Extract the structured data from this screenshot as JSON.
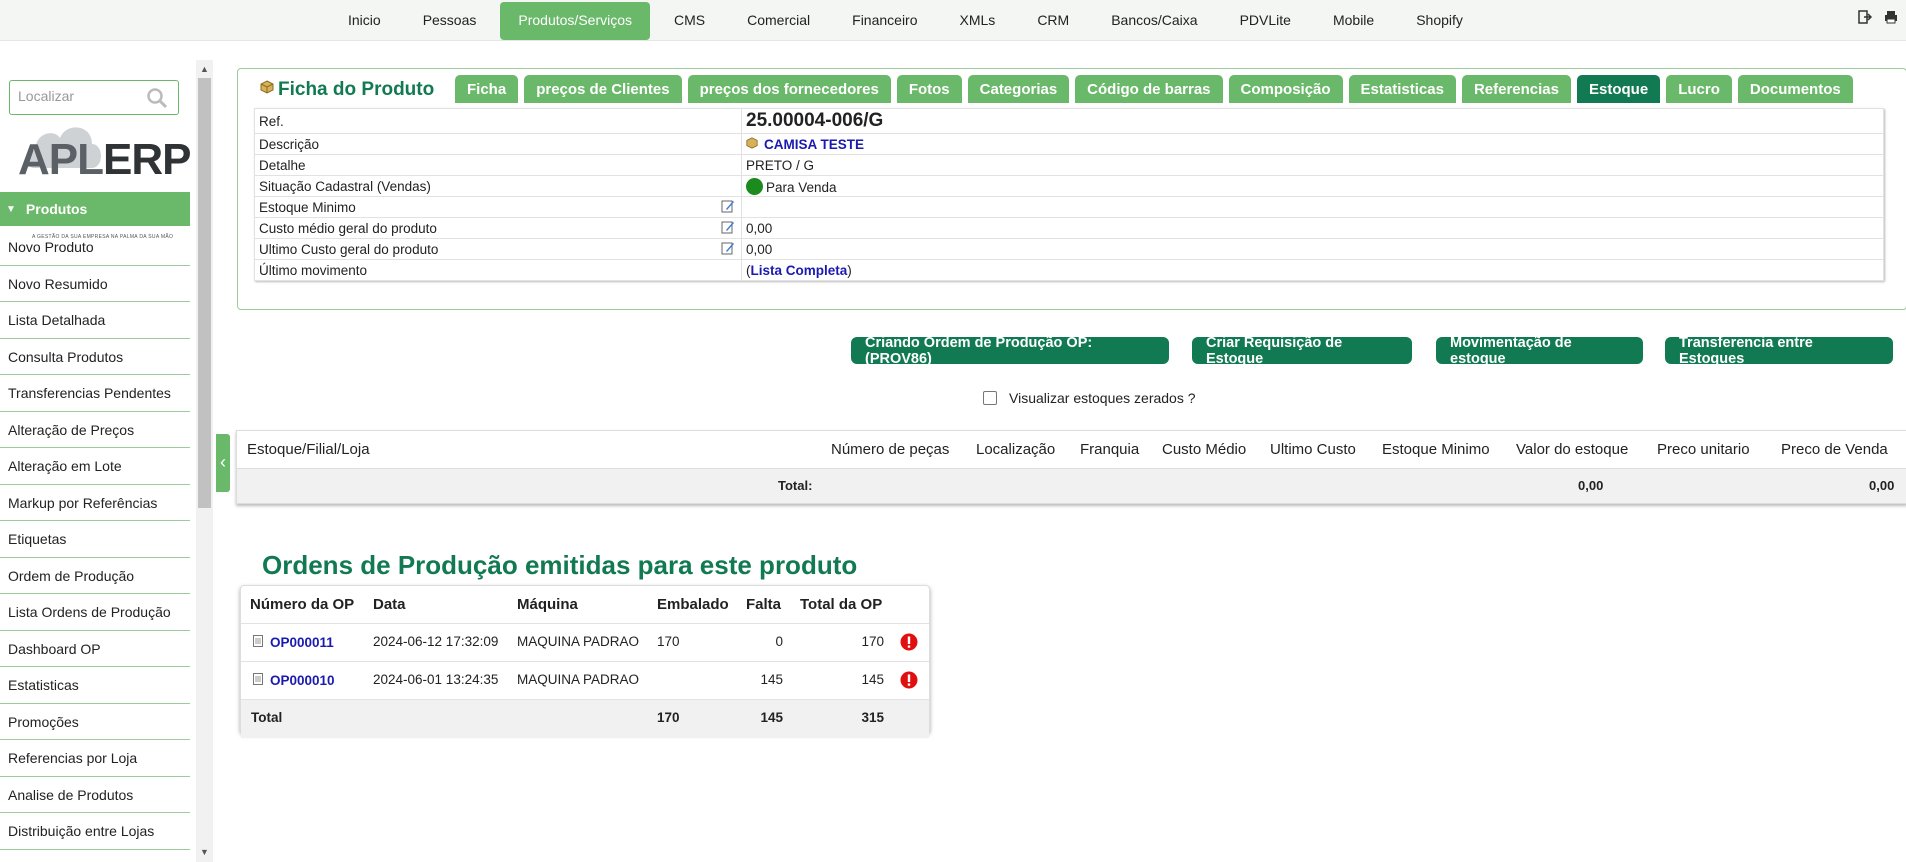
{
  "topnav": {
    "items": [
      "Inicio",
      "Pessoas",
      "Produtos/Serviços",
      "CMS",
      "Comercial",
      "Financeiro",
      "XMLs",
      "CRM",
      "Bancos/Caixa",
      "PDVLite",
      "Mobile",
      "Shopify"
    ],
    "active_index": 2,
    "tools": [
      "logout-icon",
      "print-icon"
    ]
  },
  "sidebar": {
    "search_placeholder": "Localizar",
    "logo": {
      "apl": "APL",
      "erp": "ERP",
      "tagline": "A GESTÃO DA SUA EMPRESA NA PALMA DA SUA MÃO"
    },
    "section_title": "Produtos",
    "items": [
      "Novo Produto",
      "Novo Resumido",
      "Lista Detalhada",
      "Consulta Produtos",
      "Transferencias Pendentes",
      "Alteração de Preços",
      "Alteração em Lote",
      "Markup por Referências",
      "Etiquetas",
      "Ordem de Produção",
      "Lista Ordens de Produção",
      "Dashboard OP",
      "Estatisticas",
      "Promoções",
      "Referencias por Loja",
      "Analise de Produtos",
      "Distribuição entre Lojas"
    ]
  },
  "card": {
    "title": "Ficha do Produto",
    "tabs": [
      "Ficha",
      "preços de Clientes",
      "preços dos fornecedores",
      "Fotos",
      "Categorias",
      "Código de barras",
      "Composição",
      "Estatisticas",
      "Referencias",
      "Estoque",
      "Lucro",
      "Documentos"
    ],
    "active_tab": "Estoque",
    "rows": {
      "ref_label": "Ref.",
      "ref_value": "25.00004-006/G",
      "desc_label": "Descrição",
      "desc_value": "CAMISA TESTE",
      "detail_label": "Detalhe",
      "detail_value": "PRETO / G",
      "status_label": "Situação Cadastral (Vendas)",
      "status_value": "Para Venda",
      "status_color": "#1d8a1d",
      "min_label": "Estoque Minimo",
      "min_value": "",
      "avgcost_label": "Custo médio geral do produto",
      "avgcost_value": "0,00",
      "lastcost_label": "Ultimo Custo geral do produto",
      "lastcost_value": "0,00",
      "lastmove_label": "Último movimento",
      "lastmove_link": "Lista Completa"
    }
  },
  "actions": {
    "op": "Criando Ordem de Produção OP:(PROV86)",
    "req": "Criar Requisição de Estoque",
    "mov": "Movimentação de estoque",
    "transf": "Transferencia entre Estoques"
  },
  "zero_stock_label": "Visualizar estoques zerados ?",
  "stock_table": {
    "headers": [
      "Estoque/Filial/Loja",
      "Número de peças",
      "Localização",
      "Franquia",
      "Custo Médio",
      "Ultimo Custo",
      "Estoque Minimo",
      "Valor do estoque",
      "Preco unitario",
      "Preco de Venda"
    ],
    "total_label": "Total:",
    "total_valor": "0,00",
    "total_venda": "0,00"
  },
  "op_section": {
    "title": "Ordens de Produção emitidas para este produto",
    "headers": [
      "Número da OP",
      "Data",
      "Máquina",
      "Embalado",
      "Falta",
      "Total da OP"
    ],
    "rows": [
      {
        "op": "OP000011",
        "data": "2024-06-12 17:32:09",
        "maquina": "MAQUINA PADRAO",
        "embalado": "170",
        "falta": "0",
        "total": "170"
      },
      {
        "op": "OP000010",
        "data": "2024-06-01 13:24:35",
        "maquina": "MAQUINA PADRAO",
        "embalado": "",
        "falta": "145",
        "total": "145"
      }
    ],
    "totals": {
      "label": "Total",
      "embalado": "170",
      "falta": "145",
      "total": "315"
    },
    "warn_color": "#e01010"
  }
}
